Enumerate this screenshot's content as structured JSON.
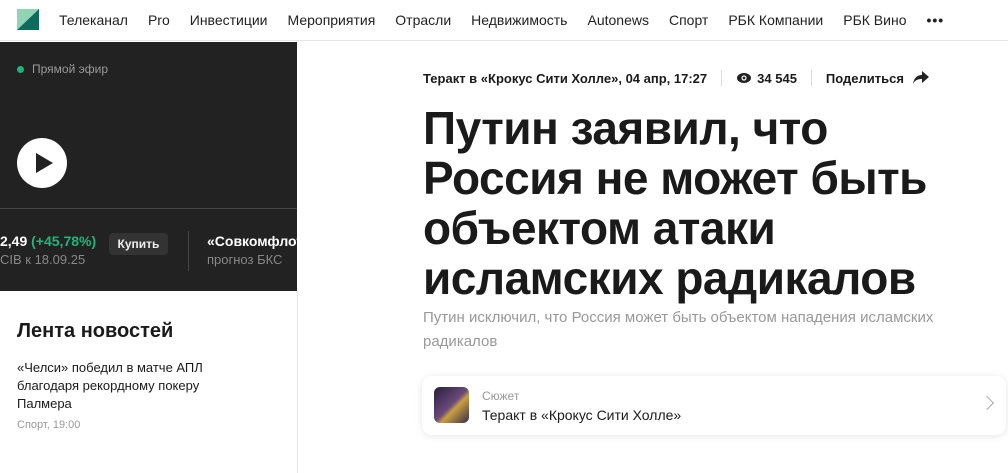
{
  "nav": [
    "Телеканал",
    "Pro",
    "Инвестиции",
    "Мероприятия",
    "Отрасли",
    "Недвижимость",
    "Autonews",
    "Спорт",
    "РБК Компании",
    "РБК Вино"
  ],
  "nav_more": "•••",
  "live": {
    "label": "Прямой эфир"
  },
  "ticker": {
    "price": "2,49",
    "change": "(+45,78%)",
    "note": "CIB к 18.09.25",
    "buy": "Купить",
    "next_title": "«Совкомфлот",
    "next_note": "прогноз БКС"
  },
  "feed": {
    "title": "Лента новостей",
    "item_title": "«Челси» победил в матче АПЛ благодаря рекордному покеру Палмера",
    "item_meta": "Спорт, 19:00"
  },
  "article": {
    "story": "Теракт в «Крокус Сити Холле», 04 апр, 17:27",
    "views": "34 545",
    "share": "Поделиться",
    "title": "Путин заявил, что Россия не может быть объектом атаки исламских радикалов",
    "subtitle": "Путин исключил, что Россия может быть объектом нападения исламских радикалов"
  },
  "card": {
    "kicker": "Сюжет",
    "title": "Теракт в «Крокус Сити Холле»"
  }
}
